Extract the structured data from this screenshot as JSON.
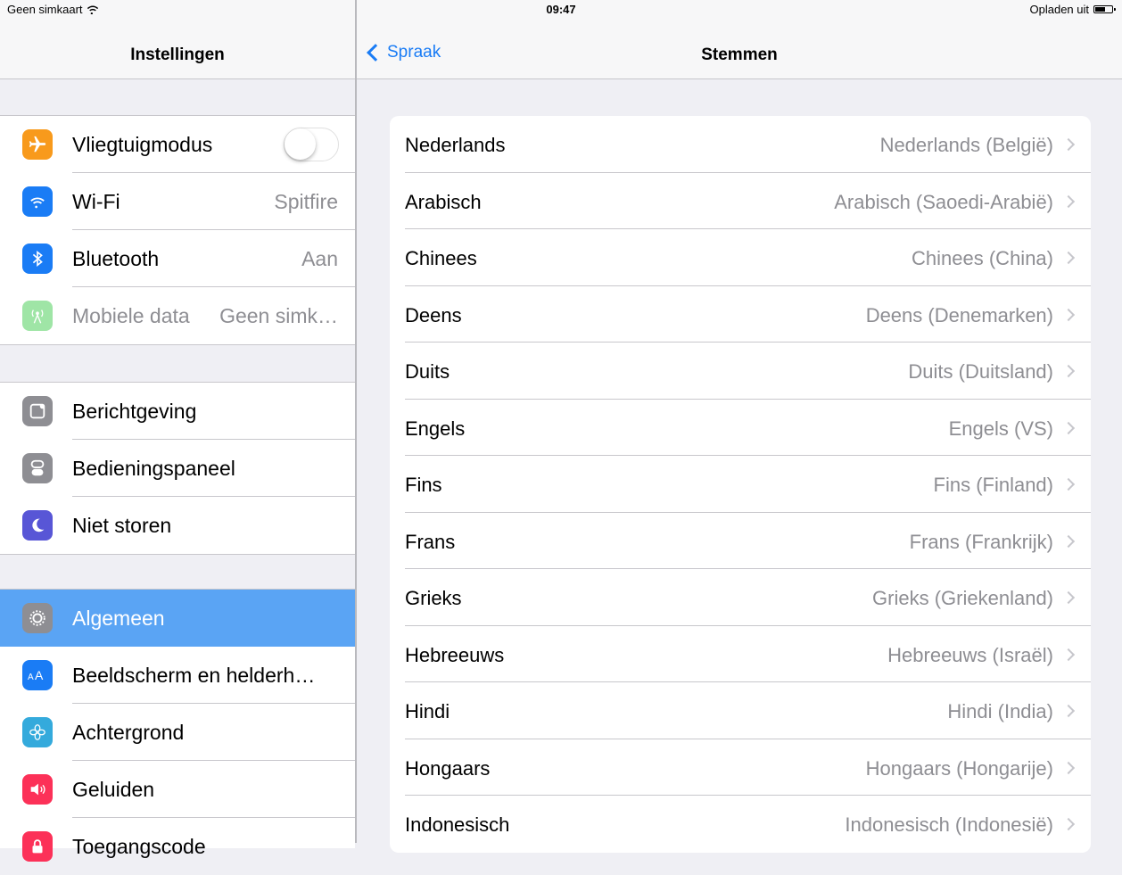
{
  "status": {
    "carrier": "Geen simkaart",
    "time": "09:47",
    "charging": "Opladen uit"
  },
  "left_nav": {
    "title": "Instellingen"
  },
  "sidebar": {
    "group1": [
      {
        "label": "Vliegtuigmodus",
        "icon": "airplane-icon",
        "color": "#f89a1c",
        "control": "toggle-off"
      },
      {
        "label": "Wi-Fi",
        "icon": "wifi-icon",
        "color": "#1a7cf5",
        "value": "Spitfire"
      },
      {
        "label": "Bluetooth",
        "icon": "bluetooth-icon",
        "color": "#1a7cf5",
        "value": "Aan"
      },
      {
        "label": "Mobiele data",
        "icon": "antenna-icon",
        "color": "#9fe5a6",
        "value": "Geen simk…"
      }
    ],
    "group2": [
      {
        "label": "Berichtgeving",
        "icon": "notifications-icon",
        "color": "#8e8e93"
      },
      {
        "label": "Bedieningspaneel",
        "icon": "control-center-icon",
        "color": "#8e8e93"
      },
      {
        "label": "Niet storen",
        "icon": "moon-icon",
        "color": "#5856d6"
      }
    ],
    "group3": [
      {
        "label": "Algemeen",
        "icon": "gear-icon",
        "color": "#8e8e93"
      },
      {
        "label": "Beeldscherm en helderh…",
        "icon": "text-size-icon",
        "color": "#1a7cf5"
      },
      {
        "label": "Achtergrond",
        "icon": "wallpaper-icon",
        "color": "#34aadc"
      },
      {
        "label": "Geluiden",
        "icon": "speaker-icon",
        "color": "#fc3158"
      },
      {
        "label": "Toegangscode",
        "icon": "lock-icon",
        "color": "#fc3158"
      }
    ]
  },
  "right_nav": {
    "back_label": "Spraak",
    "title": "Stemmen"
  },
  "voices": [
    {
      "label": "Nederlands",
      "value": "Nederlands (België)"
    },
    {
      "label": "Arabisch",
      "value": "Arabisch (Saoedi-Arabië)"
    },
    {
      "label": "Chinees",
      "value": "Chinees (China)"
    },
    {
      "label": "Deens",
      "value": "Deens (Denemarken)"
    },
    {
      "label": "Duits",
      "value": "Duits (Duitsland)"
    },
    {
      "label": "Engels",
      "value": "Engels (VS)"
    },
    {
      "label": "Fins",
      "value": "Fins (Finland)"
    },
    {
      "label": "Frans",
      "value": "Frans (Frankrijk)"
    },
    {
      "label": "Grieks",
      "value": "Grieks (Griekenland)"
    },
    {
      "label": "Hebreeuws",
      "value": "Hebreeuws (Israël)"
    },
    {
      "label": "Hindi",
      "value": "Hindi (India)"
    },
    {
      "label": "Hongaars",
      "value": "Hongaars (Hongarije)"
    },
    {
      "label": "Indonesisch",
      "value": "Indonesisch (Indonesië)"
    }
  ]
}
